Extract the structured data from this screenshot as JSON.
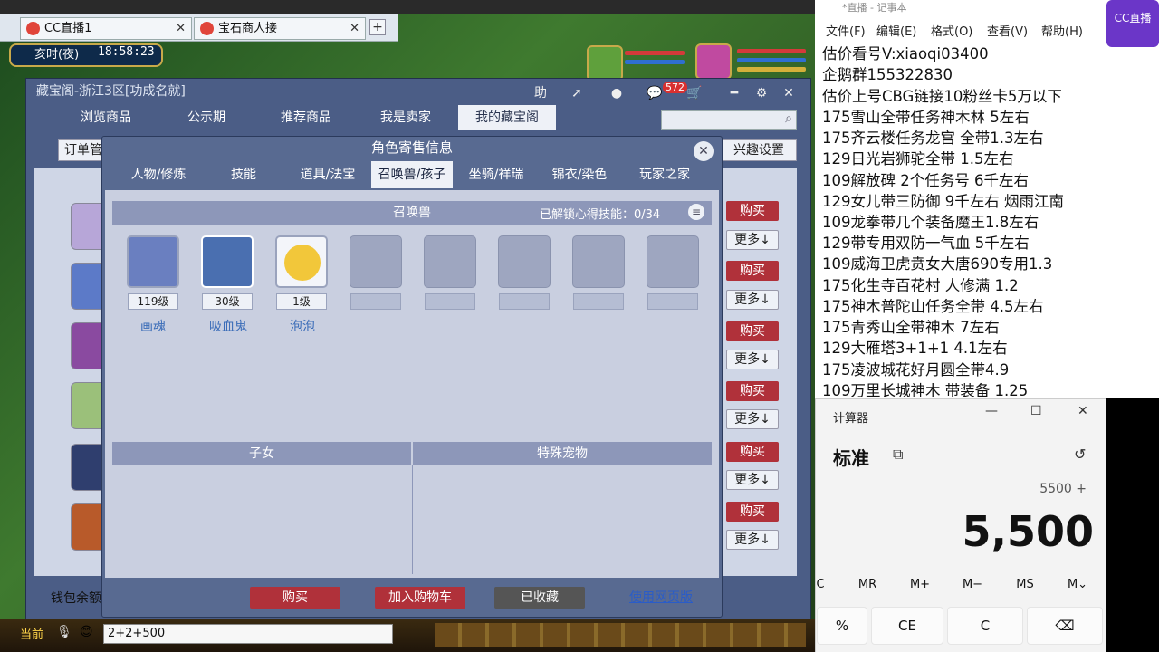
{
  "browser_tabs": [
    {
      "label": "CC直播1"
    },
    {
      "label": "宝石商人接"
    }
  ],
  "game": {
    "time_period": "亥时(夜)",
    "clock": "18:58:23",
    "chat_input": "2+2+500",
    "current_label": "当前"
  },
  "window": {
    "title": "藏宝阁-浙江3区[功成名就]",
    "help_label": "助",
    "badge_count": "572",
    "nav_tabs": [
      "浏览商品",
      "公示期",
      "推荐商品",
      "我是卖家",
      "我的藏宝阁"
    ],
    "order_label": "订单管",
    "interest_label": "兴趣设置",
    "wallet_label": "钱包余额",
    "buy_label": "购买",
    "more_label": "更多↓"
  },
  "dialog": {
    "title": "角色寄售信息",
    "tabs": [
      "人物/修炼",
      "技能",
      "道具/法宝",
      "召唤兽/孩子",
      "坐骑/祥瑞",
      "锦衣/染色",
      "玩家之家"
    ],
    "pet_panel_title": "召唤兽",
    "unlock_text": "已解锁心得技能：0/34",
    "pets": [
      {
        "level": "119级",
        "name": "画魂"
      },
      {
        "level": "30级",
        "name": "吸血鬼"
      },
      {
        "level": "1级",
        "name": "泡泡"
      }
    ],
    "children_title": "子女",
    "special_pets_title": "特殊宠物",
    "buttons": {
      "buy": "购买",
      "add_cart": "加入购物车",
      "favorited": "已收藏",
      "web": "使用网页版"
    }
  },
  "notepad": {
    "title": "*直播 - 记事本",
    "menu": [
      "文件(F)",
      "编辑(E)",
      "格式(O)",
      "查看(V)",
      "帮助(H)"
    ],
    "lines": [
      "估价看号V:xiaoqi03400",
      "企鹅群155322830",
      "估价上号CBG链接10粉丝卡5万以下",
      "175雪山全带任务神木林 5左右",
      "175齐云楼任务龙宫  全带1.3左右",
      "129日光岩狮驼全带  1.5左右",
      "109解放碑 2个任务号 6千左右",
      "129女儿带三防御 9千左右 烟雨江南",
      "109龙拳带几个装备魔王1.8左右",
      "129带专用双防一气血 5千左右",
      "109威海卫虎贲女大唐690专用1.3",
      "175化生寺百花村 人修满 1.2",
      "175神木普陀山任务全带 4.5左右",
      "175青秀山全带神木  7左右",
      "129大雁塔3+1+1  4.1左右",
      "175凌波城花好月圆全带4.9",
      "109万里长城神木 带装备  1.25"
    ],
    "watermark": "CC直播"
  },
  "calculator": {
    "title": "计算器",
    "mode": "标准",
    "expression": "5500 +",
    "display": "5,500",
    "memory_keys": [
      "C",
      "MR",
      "M+",
      "M−",
      "MS",
      "M⌄"
    ],
    "keys": [
      "%",
      "CE",
      "C",
      "⌫"
    ]
  },
  "colors": {
    "accent_red": "#b0313a",
    "panel_blue": "#586a91",
    "link": "#3a6cb8"
  }
}
